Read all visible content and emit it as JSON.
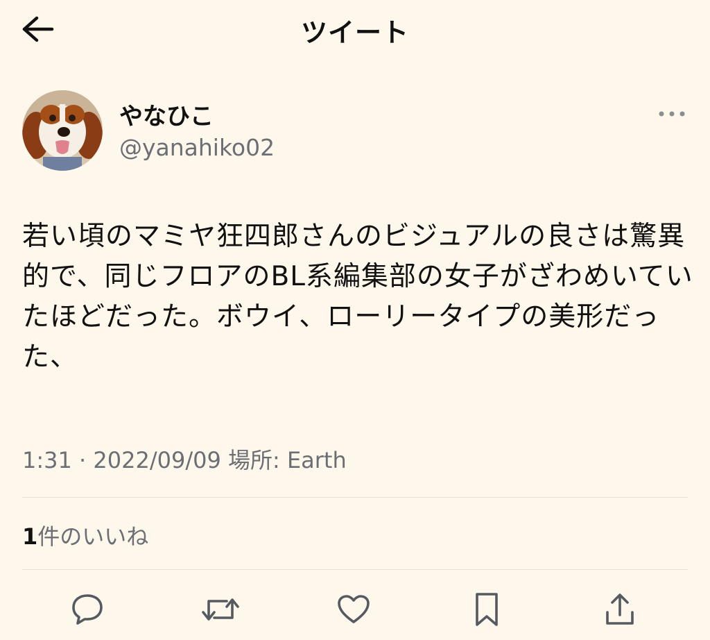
{
  "header": {
    "title": "ツイート",
    "back_icon": "arrow-left-icon"
  },
  "tweet": {
    "author": {
      "display_name": "やなひこ",
      "handle": "@yanahiko02",
      "avatar": "dog-avatar"
    },
    "more_icon": "more-dots-icon",
    "text": "若い頃のマミヤ狂四郎さんのビジュアルの良さは驚異的で、同じフロアのBL系編集部の女子がざわめいていたほどだった。ボウイ、ローリータイプの美形だった、",
    "time": "1:31",
    "separator": "·",
    "date": "2022/09/09",
    "location": "場所: Earth",
    "likes": {
      "count": "1",
      "label": "件のいいね"
    }
  },
  "actions": [
    {
      "name": "reply",
      "icon": "reply-icon"
    },
    {
      "name": "retweet",
      "icon": "retweet-icon"
    },
    {
      "name": "like",
      "icon": "heart-icon"
    },
    {
      "name": "bookmark",
      "icon": "bookmark-icon"
    },
    {
      "name": "share",
      "icon": "share-icon"
    }
  ],
  "colors": {
    "background": "#fef7ec",
    "primary_text": "#111111",
    "secondary_text": "#6b6f74",
    "divider": "#e7e0d5"
  }
}
